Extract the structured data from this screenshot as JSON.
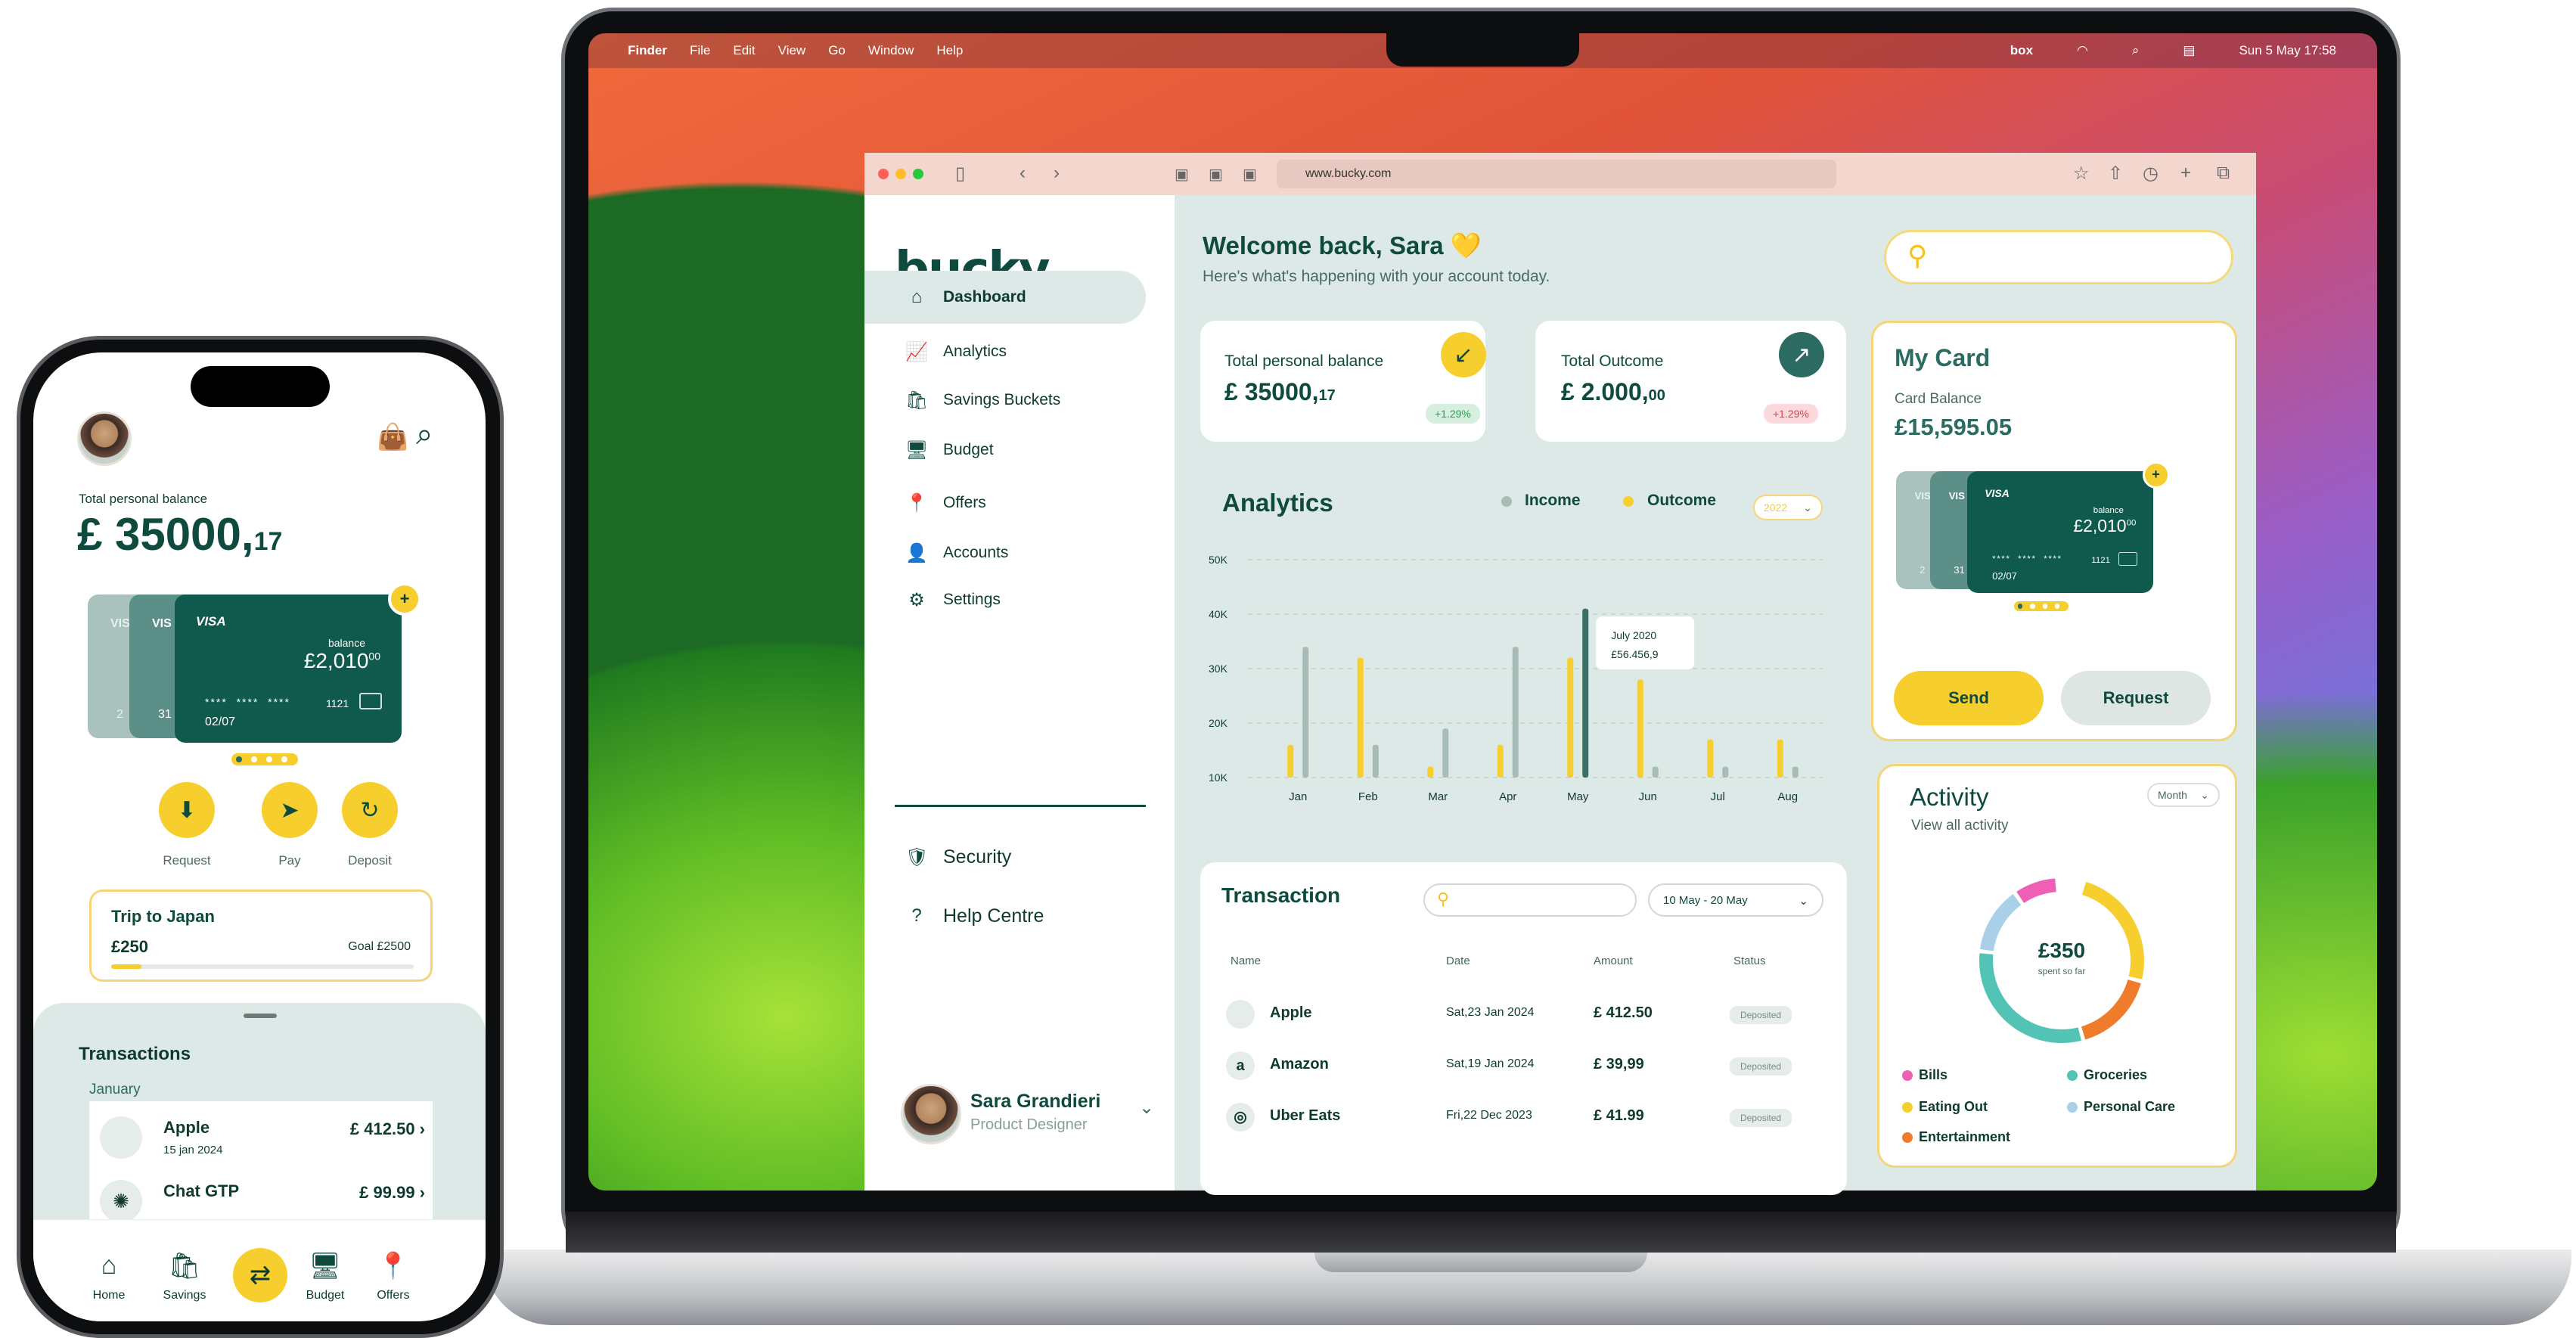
{
  "menubar": {
    "apple": "",
    "items": [
      "Finder",
      "File",
      "Edit",
      "View",
      "Go",
      "Window",
      "Help"
    ],
    "box": "box",
    "clock": "Sun 5 May  17:58"
  },
  "browser": {
    "url": "www.bucky.com"
  },
  "sidebar": {
    "logo": "bucky",
    "logo_dot": ".",
    "items": [
      {
        "label": "Dashboard",
        "icon": "home-icon",
        "glyph": "⌂"
      },
      {
        "label": "Analytics",
        "icon": "analytics-icon",
        "glyph": "📈"
      },
      {
        "label": "Savings Buckets",
        "icon": "bucket-icon",
        "glyph": "🛍"
      },
      {
        "label": "Budget",
        "icon": "budget-icon",
        "glyph": "🖥"
      },
      {
        "label": "Offers",
        "icon": "location-pin-icon",
        "glyph": "📍"
      },
      {
        "label": "Accounts",
        "icon": "user-icon",
        "glyph": "👤"
      },
      {
        "label": "Settings",
        "icon": "gear-icon",
        "glyph": "⚙"
      }
    ],
    "bottom": [
      {
        "label": "Security",
        "icon": "shield-icon",
        "glyph": "🛡"
      },
      {
        "label": "Help Centre",
        "icon": "help-icon",
        "glyph": "?"
      }
    ],
    "user": {
      "name": "Sara Grandieri",
      "role": "Product Designer"
    }
  },
  "header": {
    "title": "Welcome back, Sara 💛",
    "subtitle": "Here's what's happening with your account today."
  },
  "balance": {
    "label": "Total personal balance",
    "value": "£ 35000,",
    "cents": "17",
    "change": "+1.29%"
  },
  "outcome": {
    "label": "Total Outcome",
    "value": "£ 2.000,",
    "cents": "00",
    "change": "+1.29%"
  },
  "analytics": {
    "title": "Analytics",
    "legend_income": "Income",
    "legend_outcome": "Outcome",
    "year": "2022"
  },
  "chart_data": {
    "type": "bar",
    "categories": [
      "Jan",
      "Feb",
      "Mar",
      "Apr",
      "May",
      "Jun",
      "Jul",
      "Aug"
    ],
    "series": [
      {
        "name": "Income",
        "color": "#f6cf2f",
        "values": [
          16000,
          32000,
          12000,
          16000,
          32000,
          28000,
          17000,
          17000
        ]
      },
      {
        "name": "Outcome",
        "color": "#a7bcb6",
        "values": [
          34000,
          16000,
          19000,
          34000,
          41000,
          12000,
          12000,
          12000
        ]
      }
    ],
    "highlight": {
      "category": "May",
      "series": "Outcome",
      "color": "#3a6f66"
    },
    "ylim": [
      10000,
      50000
    ],
    "yticks": [
      "10K",
      "20K",
      "30K",
      "40K",
      "50K"
    ],
    "tooltip": {
      "line1": "July 2020",
      "line2": "£56.456,9"
    }
  },
  "transactions": {
    "title": "Transaction",
    "date_range": "10 May - 20 May",
    "cols": [
      "Name",
      "Date",
      "Amount",
      "Status"
    ],
    "rows": [
      {
        "name": "Apple",
        "icon": "apple-icon",
        "glyph": "",
        "date": "Sat,23 Jan 2024",
        "amount": "£ 412.50",
        "status": "Deposited"
      },
      {
        "name": "Amazon",
        "icon": "amazon-icon",
        "glyph": "a",
        "date": "Sat,19 Jan 2024",
        "amount": "£ 39,99",
        "status": "Deposited"
      },
      {
        "name": "Uber Eats",
        "icon": "uber-eats-icon",
        "glyph": "◎",
        "date": "Fri,22 Dec 2023",
        "amount": "£ 41.99",
        "status": "Deposited"
      }
    ]
  },
  "mycard": {
    "title": "My Card",
    "balance_label": "Card Balance",
    "balance": "£15,595.05",
    "send": "Send",
    "request": "Request",
    "card": {
      "brand": "VISA",
      "brand_short": "VIS",
      "balance_label": "balance",
      "balance": "£2,010",
      "balance_cents": "00",
      "mask": "****  ****  ****",
      "last4": "1121",
      "expiry": "02/07",
      "back_last": "31",
      "back_last2": "2"
    }
  },
  "activity": {
    "title": "Activity",
    "sub": "View all activity",
    "period": "Month",
    "amount": "£350",
    "amount_sub": "spent so far",
    "legend": [
      {
        "label": "Bills",
        "color": "#ee5fb5"
      },
      {
        "label": "Groceries",
        "color": "#52c3b4"
      },
      {
        "label": "Eating Out",
        "color": "#f6cf2f"
      },
      {
        "label": "Personal Care",
        "color": "#a9d0e8"
      },
      {
        "label": "Entertainment",
        "color": "#f07c2b"
      }
    ]
  },
  "phone": {
    "balance_label": "Total personal balance",
    "balance": "£ 35000,",
    "cents": "17",
    "actions": [
      {
        "label": "Request",
        "icon": "request-icon",
        "glyph": "⬇"
      },
      {
        "label": "Pay",
        "icon": "send-icon",
        "glyph": "➤"
      },
      {
        "label": "Deposit",
        "icon": "deposit-icon",
        "glyph": "↻"
      }
    ],
    "goal": {
      "title": "Trip to Japan",
      "amount": "£250",
      "goal": "Goal £2500",
      "progress": 0.1
    },
    "transactions_title": "Transactions",
    "month": "January",
    "tx": [
      {
        "name": "Apple",
        "icon": "apple-icon",
        "glyph": "",
        "date": "15 jan 2024",
        "amount": "£ 412.50 ›"
      },
      {
        "name": "Chat GTP",
        "icon": "chatgpt-icon",
        "glyph": "✺",
        "date": "",
        "amount": "£ 99.99 ›"
      }
    ],
    "nav": [
      {
        "label": "Home",
        "icon": "home-icon",
        "glyph": "⌂"
      },
      {
        "label": "Savings",
        "icon": "bucket-icon",
        "glyph": "🛍"
      },
      {
        "label": "",
        "icon": "transfer-icon",
        "glyph": "⇄"
      },
      {
        "label": "Budget",
        "icon": "budget-icon",
        "glyph": "🖥"
      },
      {
        "label": "Offers",
        "icon": "location-pin-icon",
        "glyph": "📍"
      }
    ]
  }
}
